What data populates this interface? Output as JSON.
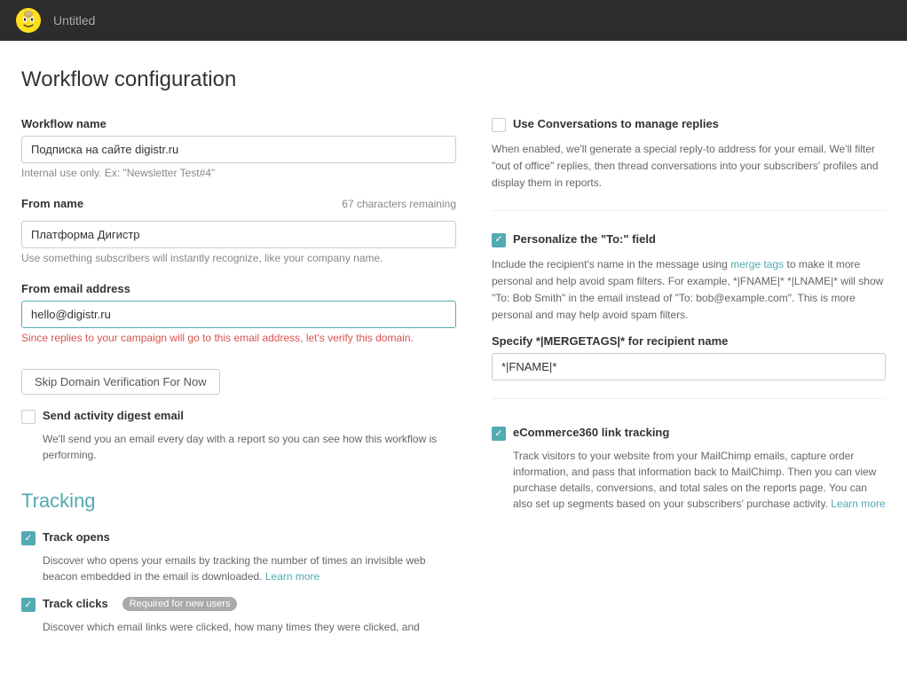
{
  "topnav": {
    "title": "Untitled"
  },
  "page": {
    "title": "Workflow configuration"
  },
  "left": {
    "workflow_name_label": "Workflow name",
    "workflow_name_value": "Подписка на сайте digistr.ru",
    "workflow_name_hint": "Internal use only. Ex: \"Newsletter Test#4\"",
    "from_name_label": "From name",
    "from_name_chars": "67 characters remaining",
    "from_name_value": "Платформа Дигистр",
    "from_name_hint": "Use something subscribers will instantly recognize, like your company name.",
    "from_email_label": "From email address",
    "from_email_value": "hello@digistr.ru",
    "from_email_error": "Since replies to your campaign will go to this email address, let's verify this domain.",
    "skip_button_label": "Skip Domain Verification For Now",
    "send_digest_label": "Send activity digest email",
    "send_digest_checked": false,
    "send_digest_desc": "We'll send you an email every day with a report so you can see how this workflow is performing."
  },
  "right": {
    "conversations_label": "Use Conversations to manage replies",
    "conversations_checked": false,
    "conversations_desc": "When enabled, we'll generate a special reply-to address for your email. We'll filter \"out of office\" replies, then thread conversations into your subscribers' profiles and display them in reports.",
    "personalize_label": "Personalize the \"To:\" field",
    "personalize_checked": true,
    "personalize_desc_part1": "Include the recipient's name in the message using ",
    "personalize_link": "merge tags",
    "personalize_desc_part2": " to make it more personal and help avoid spam filters. For example, *|FNAME|* *|LNAME|* will show \"To: Bob Smith\" in the email instead of \"To: bob@example.com\". This is more personal and may help avoid spam filters.",
    "merge_tags_label": "Specify *|MERGETAGS|* for recipient name",
    "merge_tags_value": "*|FNAME|*"
  },
  "tracking": {
    "section_title": "Tracking",
    "track_opens_label": "Track opens",
    "track_opens_checked": true,
    "track_opens_desc": "Discover who opens your emails by tracking the number of times an invisible web beacon embedded in the email is downloaded.",
    "track_opens_link": "Learn more",
    "track_clicks_label": "Track clicks",
    "track_clicks_checked": true,
    "track_clicks_badge": "Required for new users",
    "track_clicks_desc": "Discover which email links were clicked, how many times they were clicked, and",
    "ecommerce_label": "eCommerce360 link tracking",
    "ecommerce_checked": true,
    "ecommerce_desc": "Track visitors to your website from your MailChimp emails, capture order information, and pass that information back to MailChimp. Then you can view purchase details, conversions, and total sales on the reports page. You can also set up segments based on your subscribers' purchase activity.",
    "ecommerce_link": "Learn more"
  }
}
